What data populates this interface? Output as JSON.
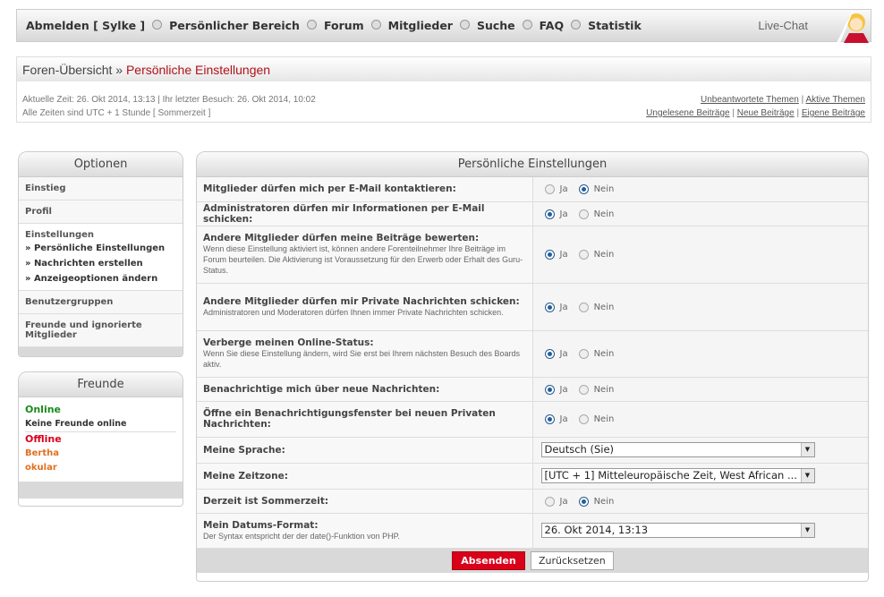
{
  "nav": {
    "items": [
      "Abmelden [ Sylke ]",
      "Persönlicher Bereich",
      "Forum",
      "Mitglieder",
      "Suche",
      "FAQ",
      "Statistik"
    ],
    "livechat": "Live-Chat"
  },
  "breadcrumb": {
    "root": "Foren-Übersicht",
    "sep": " » ",
    "current": "Persönliche Einstellungen"
  },
  "info": {
    "line1": "Aktuelle Zeit: 26. Okt 2014, 13:13 | Ihr letzter Besuch: 26. Okt 2014, 10:02",
    "line2": "Alle Zeiten sind UTC + 1 Stunde [ Sommerzeit ]",
    "links1": [
      "Unbeantwortete Themen",
      "Aktive Themen"
    ],
    "links2": [
      "Ungelesene Beiträge",
      "Neue Beiträge",
      "Eigene Beiträge"
    ]
  },
  "options": {
    "title": "Optionen",
    "items": [
      "Einstieg",
      "Profil"
    ],
    "group": "Einstellungen",
    "subs": [
      "» Persönliche Einstellungen",
      "» Nachrichten erstellen",
      "» Anzeigeoptionen ändern"
    ],
    "items2": [
      "Benutzergruppen",
      "Freunde und ignorierte Mitglieder"
    ]
  },
  "friends": {
    "title": "Freunde",
    "online": "Online",
    "none": "Keine Freunde online",
    "offline": "Offline",
    "list": [
      "Bertha",
      "okular"
    ],
    "colors": {
      "online": "#1a8a1a",
      "offline": "#d9001b",
      "name": "#e07020"
    }
  },
  "main": {
    "title": "Persönliche Einstellungen",
    "yes": "Ja",
    "no": "Nein",
    "rows": [
      {
        "label": "Mitglieder dürfen mich per E-Mail kontaktieren:",
        "type": "radio",
        "value": "no",
        "h": 27
      },
      {
        "label": "Administratoren dürfen mir Informationen per E-Mail schicken:",
        "type": "radio",
        "value": "yes",
        "h": 27
      },
      {
        "label": "Andere Mitglieder dürfen meine Beiträge bewerten:",
        "desc": "Wenn diese Einstellung aktiviert ist, können andere Forenteilnehmer Ihre Beiträge im Forum beurteilen. Die Aktivierung ist Voraussetzung für den Erwerb oder Erhalt des Guru-Status.",
        "type": "radio",
        "value": "yes",
        "h": 64
      },
      {
        "label": "Andere Mitglieder dürfen mir Private Nachrichten schicken:",
        "desc": "Administratoren und Moderatoren dürfen Ihnen immer Private Nachrichten schicken.",
        "type": "radio",
        "value": "yes",
        "h": 53
      },
      {
        "label": "Verberge meinen Online-Status:",
        "desc": "Wenn Sie diese Einstellung ändern, wird Sie erst bei Ihrem nächsten Besuch des Boards aktiv.",
        "type": "radio",
        "value": "yes",
        "h": 52
      },
      {
        "label": "Benachrichtige mich über neue Nachrichten:",
        "type": "radio",
        "value": "yes",
        "h": 27
      },
      {
        "label": "Öffne ein Benachrichtigungsfenster bei neuen Privaten Nachrichten:",
        "type": "radio",
        "value": "yes",
        "h": 40
      },
      {
        "label": "Meine Sprache:",
        "type": "select",
        "value": "Deutsch (Sie)",
        "h": 29
      },
      {
        "label": "Meine Zeitzone:",
        "type": "select",
        "value": "[UTC + 1] Mitteleuropäische Zeit, West African ...",
        "h": 29
      },
      {
        "label": "Derzeit ist Sommerzeit:",
        "type": "radio",
        "value": "no",
        "h": 27
      },
      {
        "label": "Mein Datums-Format:",
        "desc": "Der Syntax entspricht der der date()-Funktion von PHP.",
        "type": "select",
        "value": "26. Okt 2014, 13:13",
        "h": 39
      }
    ],
    "submit": "Absenden",
    "reset": "Zurücksetzen"
  }
}
